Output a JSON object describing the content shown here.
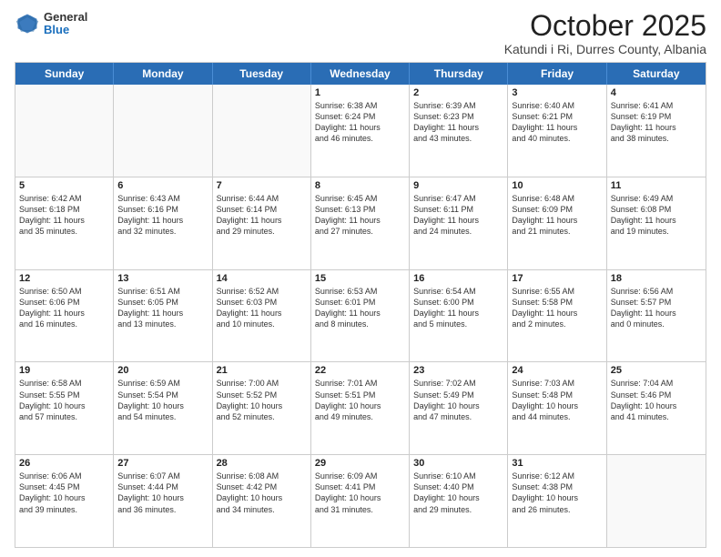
{
  "header": {
    "logo": {
      "general": "General",
      "blue": "Blue"
    },
    "title": "October 2025",
    "subtitle": "Katundi i Ri, Durres County, Albania"
  },
  "calendar": {
    "weekdays": [
      "Sunday",
      "Monday",
      "Tuesday",
      "Wednesday",
      "Thursday",
      "Friday",
      "Saturday"
    ],
    "rows": [
      [
        {
          "day": "",
          "info": ""
        },
        {
          "day": "",
          "info": ""
        },
        {
          "day": "",
          "info": ""
        },
        {
          "day": "1",
          "info": "Sunrise: 6:38 AM\nSunset: 6:24 PM\nDaylight: 11 hours\nand 46 minutes."
        },
        {
          "day": "2",
          "info": "Sunrise: 6:39 AM\nSunset: 6:23 PM\nDaylight: 11 hours\nand 43 minutes."
        },
        {
          "day": "3",
          "info": "Sunrise: 6:40 AM\nSunset: 6:21 PM\nDaylight: 11 hours\nand 40 minutes."
        },
        {
          "day": "4",
          "info": "Sunrise: 6:41 AM\nSunset: 6:19 PM\nDaylight: 11 hours\nand 38 minutes."
        }
      ],
      [
        {
          "day": "5",
          "info": "Sunrise: 6:42 AM\nSunset: 6:18 PM\nDaylight: 11 hours\nand 35 minutes."
        },
        {
          "day": "6",
          "info": "Sunrise: 6:43 AM\nSunset: 6:16 PM\nDaylight: 11 hours\nand 32 minutes."
        },
        {
          "day": "7",
          "info": "Sunrise: 6:44 AM\nSunset: 6:14 PM\nDaylight: 11 hours\nand 29 minutes."
        },
        {
          "day": "8",
          "info": "Sunrise: 6:45 AM\nSunset: 6:13 PM\nDaylight: 11 hours\nand 27 minutes."
        },
        {
          "day": "9",
          "info": "Sunrise: 6:47 AM\nSunset: 6:11 PM\nDaylight: 11 hours\nand 24 minutes."
        },
        {
          "day": "10",
          "info": "Sunrise: 6:48 AM\nSunset: 6:09 PM\nDaylight: 11 hours\nand 21 minutes."
        },
        {
          "day": "11",
          "info": "Sunrise: 6:49 AM\nSunset: 6:08 PM\nDaylight: 11 hours\nand 19 minutes."
        }
      ],
      [
        {
          "day": "12",
          "info": "Sunrise: 6:50 AM\nSunset: 6:06 PM\nDaylight: 11 hours\nand 16 minutes."
        },
        {
          "day": "13",
          "info": "Sunrise: 6:51 AM\nSunset: 6:05 PM\nDaylight: 11 hours\nand 13 minutes."
        },
        {
          "day": "14",
          "info": "Sunrise: 6:52 AM\nSunset: 6:03 PM\nDaylight: 11 hours\nand 10 minutes."
        },
        {
          "day": "15",
          "info": "Sunrise: 6:53 AM\nSunset: 6:01 PM\nDaylight: 11 hours\nand 8 minutes."
        },
        {
          "day": "16",
          "info": "Sunrise: 6:54 AM\nSunset: 6:00 PM\nDaylight: 11 hours\nand 5 minutes."
        },
        {
          "day": "17",
          "info": "Sunrise: 6:55 AM\nSunset: 5:58 PM\nDaylight: 11 hours\nand 2 minutes."
        },
        {
          "day": "18",
          "info": "Sunrise: 6:56 AM\nSunset: 5:57 PM\nDaylight: 11 hours\nand 0 minutes."
        }
      ],
      [
        {
          "day": "19",
          "info": "Sunrise: 6:58 AM\nSunset: 5:55 PM\nDaylight: 10 hours\nand 57 minutes."
        },
        {
          "day": "20",
          "info": "Sunrise: 6:59 AM\nSunset: 5:54 PM\nDaylight: 10 hours\nand 54 minutes."
        },
        {
          "day": "21",
          "info": "Sunrise: 7:00 AM\nSunset: 5:52 PM\nDaylight: 10 hours\nand 52 minutes."
        },
        {
          "day": "22",
          "info": "Sunrise: 7:01 AM\nSunset: 5:51 PM\nDaylight: 10 hours\nand 49 minutes."
        },
        {
          "day": "23",
          "info": "Sunrise: 7:02 AM\nSunset: 5:49 PM\nDaylight: 10 hours\nand 47 minutes."
        },
        {
          "day": "24",
          "info": "Sunrise: 7:03 AM\nSunset: 5:48 PM\nDaylight: 10 hours\nand 44 minutes."
        },
        {
          "day": "25",
          "info": "Sunrise: 7:04 AM\nSunset: 5:46 PM\nDaylight: 10 hours\nand 41 minutes."
        }
      ],
      [
        {
          "day": "26",
          "info": "Sunrise: 6:06 AM\nSunset: 4:45 PM\nDaylight: 10 hours\nand 39 minutes."
        },
        {
          "day": "27",
          "info": "Sunrise: 6:07 AM\nSunset: 4:44 PM\nDaylight: 10 hours\nand 36 minutes."
        },
        {
          "day": "28",
          "info": "Sunrise: 6:08 AM\nSunset: 4:42 PM\nDaylight: 10 hours\nand 34 minutes."
        },
        {
          "day": "29",
          "info": "Sunrise: 6:09 AM\nSunset: 4:41 PM\nDaylight: 10 hours\nand 31 minutes."
        },
        {
          "day": "30",
          "info": "Sunrise: 6:10 AM\nSunset: 4:40 PM\nDaylight: 10 hours\nand 29 minutes."
        },
        {
          "day": "31",
          "info": "Sunrise: 6:12 AM\nSunset: 4:38 PM\nDaylight: 10 hours\nand 26 minutes."
        },
        {
          "day": "",
          "info": ""
        }
      ]
    ]
  }
}
